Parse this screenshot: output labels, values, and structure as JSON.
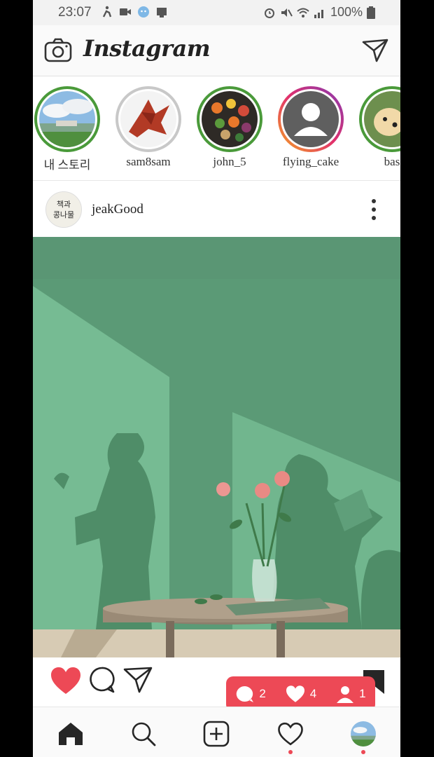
{
  "status_bar": {
    "time": "23:07",
    "battery": "100%"
  },
  "app": {
    "title": "Instagram"
  },
  "stories": [
    {
      "label": "내 스토리",
      "ring": "green"
    },
    {
      "label": "sam8sam",
      "ring": "grey"
    },
    {
      "label": "john_5",
      "ring": "green"
    },
    {
      "label": "flying_cake",
      "ring": "gradient"
    },
    {
      "label": "bas",
      "ring": "green"
    }
  ],
  "post": {
    "username": "jeakGood",
    "avatar_text": "책과 콩나물"
  },
  "notifications": {
    "comments": "2",
    "likes": "4",
    "follows": "1"
  },
  "colors": {
    "accent": "#ed4956",
    "story_green": "#4a9a3a",
    "wall": "#5c9c76"
  },
  "icons": [
    "camera-icon",
    "direct-send-icon",
    "more-options-icon",
    "heart-icon",
    "comment-icon",
    "share-icon",
    "bookmark-icon",
    "home-icon",
    "search-icon",
    "add-post-icon",
    "activity-heart-icon"
  ]
}
